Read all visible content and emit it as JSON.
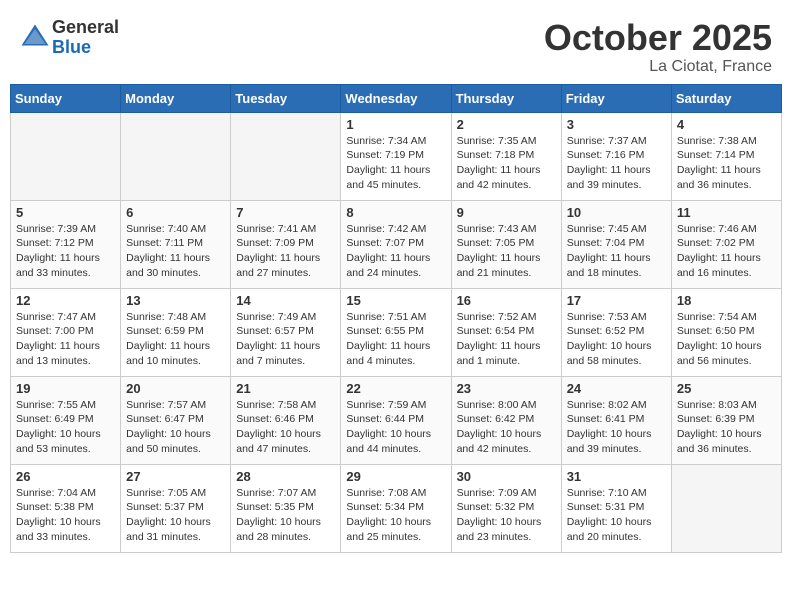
{
  "header": {
    "logo_general": "General",
    "logo_blue": "Blue",
    "month_title": "October 2025",
    "location": "La Ciotat, France"
  },
  "days_of_week": [
    "Sunday",
    "Monday",
    "Tuesday",
    "Wednesday",
    "Thursday",
    "Friday",
    "Saturday"
  ],
  "weeks": [
    [
      {
        "num": "",
        "info": "",
        "empty": true
      },
      {
        "num": "",
        "info": "",
        "empty": true
      },
      {
        "num": "",
        "info": "",
        "empty": true
      },
      {
        "num": "1",
        "info": "Sunrise: 7:34 AM\nSunset: 7:19 PM\nDaylight: 11 hours and 45 minutes."
      },
      {
        "num": "2",
        "info": "Sunrise: 7:35 AM\nSunset: 7:18 PM\nDaylight: 11 hours and 42 minutes."
      },
      {
        "num": "3",
        "info": "Sunrise: 7:37 AM\nSunset: 7:16 PM\nDaylight: 11 hours and 39 minutes."
      },
      {
        "num": "4",
        "info": "Sunrise: 7:38 AM\nSunset: 7:14 PM\nDaylight: 11 hours and 36 minutes."
      }
    ],
    [
      {
        "num": "5",
        "info": "Sunrise: 7:39 AM\nSunset: 7:12 PM\nDaylight: 11 hours and 33 minutes."
      },
      {
        "num": "6",
        "info": "Sunrise: 7:40 AM\nSunset: 7:11 PM\nDaylight: 11 hours and 30 minutes."
      },
      {
        "num": "7",
        "info": "Sunrise: 7:41 AM\nSunset: 7:09 PM\nDaylight: 11 hours and 27 minutes."
      },
      {
        "num": "8",
        "info": "Sunrise: 7:42 AM\nSunset: 7:07 PM\nDaylight: 11 hours and 24 minutes."
      },
      {
        "num": "9",
        "info": "Sunrise: 7:43 AM\nSunset: 7:05 PM\nDaylight: 11 hours and 21 minutes."
      },
      {
        "num": "10",
        "info": "Sunrise: 7:45 AM\nSunset: 7:04 PM\nDaylight: 11 hours and 18 minutes."
      },
      {
        "num": "11",
        "info": "Sunrise: 7:46 AM\nSunset: 7:02 PM\nDaylight: 11 hours and 16 minutes."
      }
    ],
    [
      {
        "num": "12",
        "info": "Sunrise: 7:47 AM\nSunset: 7:00 PM\nDaylight: 11 hours and 13 minutes."
      },
      {
        "num": "13",
        "info": "Sunrise: 7:48 AM\nSunset: 6:59 PM\nDaylight: 11 hours and 10 minutes."
      },
      {
        "num": "14",
        "info": "Sunrise: 7:49 AM\nSunset: 6:57 PM\nDaylight: 11 hours and 7 minutes."
      },
      {
        "num": "15",
        "info": "Sunrise: 7:51 AM\nSunset: 6:55 PM\nDaylight: 11 hours and 4 minutes."
      },
      {
        "num": "16",
        "info": "Sunrise: 7:52 AM\nSunset: 6:54 PM\nDaylight: 11 hours and 1 minute."
      },
      {
        "num": "17",
        "info": "Sunrise: 7:53 AM\nSunset: 6:52 PM\nDaylight: 10 hours and 58 minutes."
      },
      {
        "num": "18",
        "info": "Sunrise: 7:54 AM\nSunset: 6:50 PM\nDaylight: 10 hours and 56 minutes."
      }
    ],
    [
      {
        "num": "19",
        "info": "Sunrise: 7:55 AM\nSunset: 6:49 PM\nDaylight: 10 hours and 53 minutes."
      },
      {
        "num": "20",
        "info": "Sunrise: 7:57 AM\nSunset: 6:47 PM\nDaylight: 10 hours and 50 minutes."
      },
      {
        "num": "21",
        "info": "Sunrise: 7:58 AM\nSunset: 6:46 PM\nDaylight: 10 hours and 47 minutes."
      },
      {
        "num": "22",
        "info": "Sunrise: 7:59 AM\nSunset: 6:44 PM\nDaylight: 10 hours and 44 minutes."
      },
      {
        "num": "23",
        "info": "Sunrise: 8:00 AM\nSunset: 6:42 PM\nDaylight: 10 hours and 42 minutes."
      },
      {
        "num": "24",
        "info": "Sunrise: 8:02 AM\nSunset: 6:41 PM\nDaylight: 10 hours and 39 minutes."
      },
      {
        "num": "25",
        "info": "Sunrise: 8:03 AM\nSunset: 6:39 PM\nDaylight: 10 hours and 36 minutes."
      }
    ],
    [
      {
        "num": "26",
        "info": "Sunrise: 7:04 AM\nSunset: 5:38 PM\nDaylight: 10 hours and 33 minutes."
      },
      {
        "num": "27",
        "info": "Sunrise: 7:05 AM\nSunset: 5:37 PM\nDaylight: 10 hours and 31 minutes."
      },
      {
        "num": "28",
        "info": "Sunrise: 7:07 AM\nSunset: 5:35 PM\nDaylight: 10 hours and 28 minutes."
      },
      {
        "num": "29",
        "info": "Sunrise: 7:08 AM\nSunset: 5:34 PM\nDaylight: 10 hours and 25 minutes."
      },
      {
        "num": "30",
        "info": "Sunrise: 7:09 AM\nSunset: 5:32 PM\nDaylight: 10 hours and 23 minutes."
      },
      {
        "num": "31",
        "info": "Sunrise: 7:10 AM\nSunset: 5:31 PM\nDaylight: 10 hours and 20 minutes."
      },
      {
        "num": "",
        "info": "",
        "empty": true
      }
    ]
  ]
}
